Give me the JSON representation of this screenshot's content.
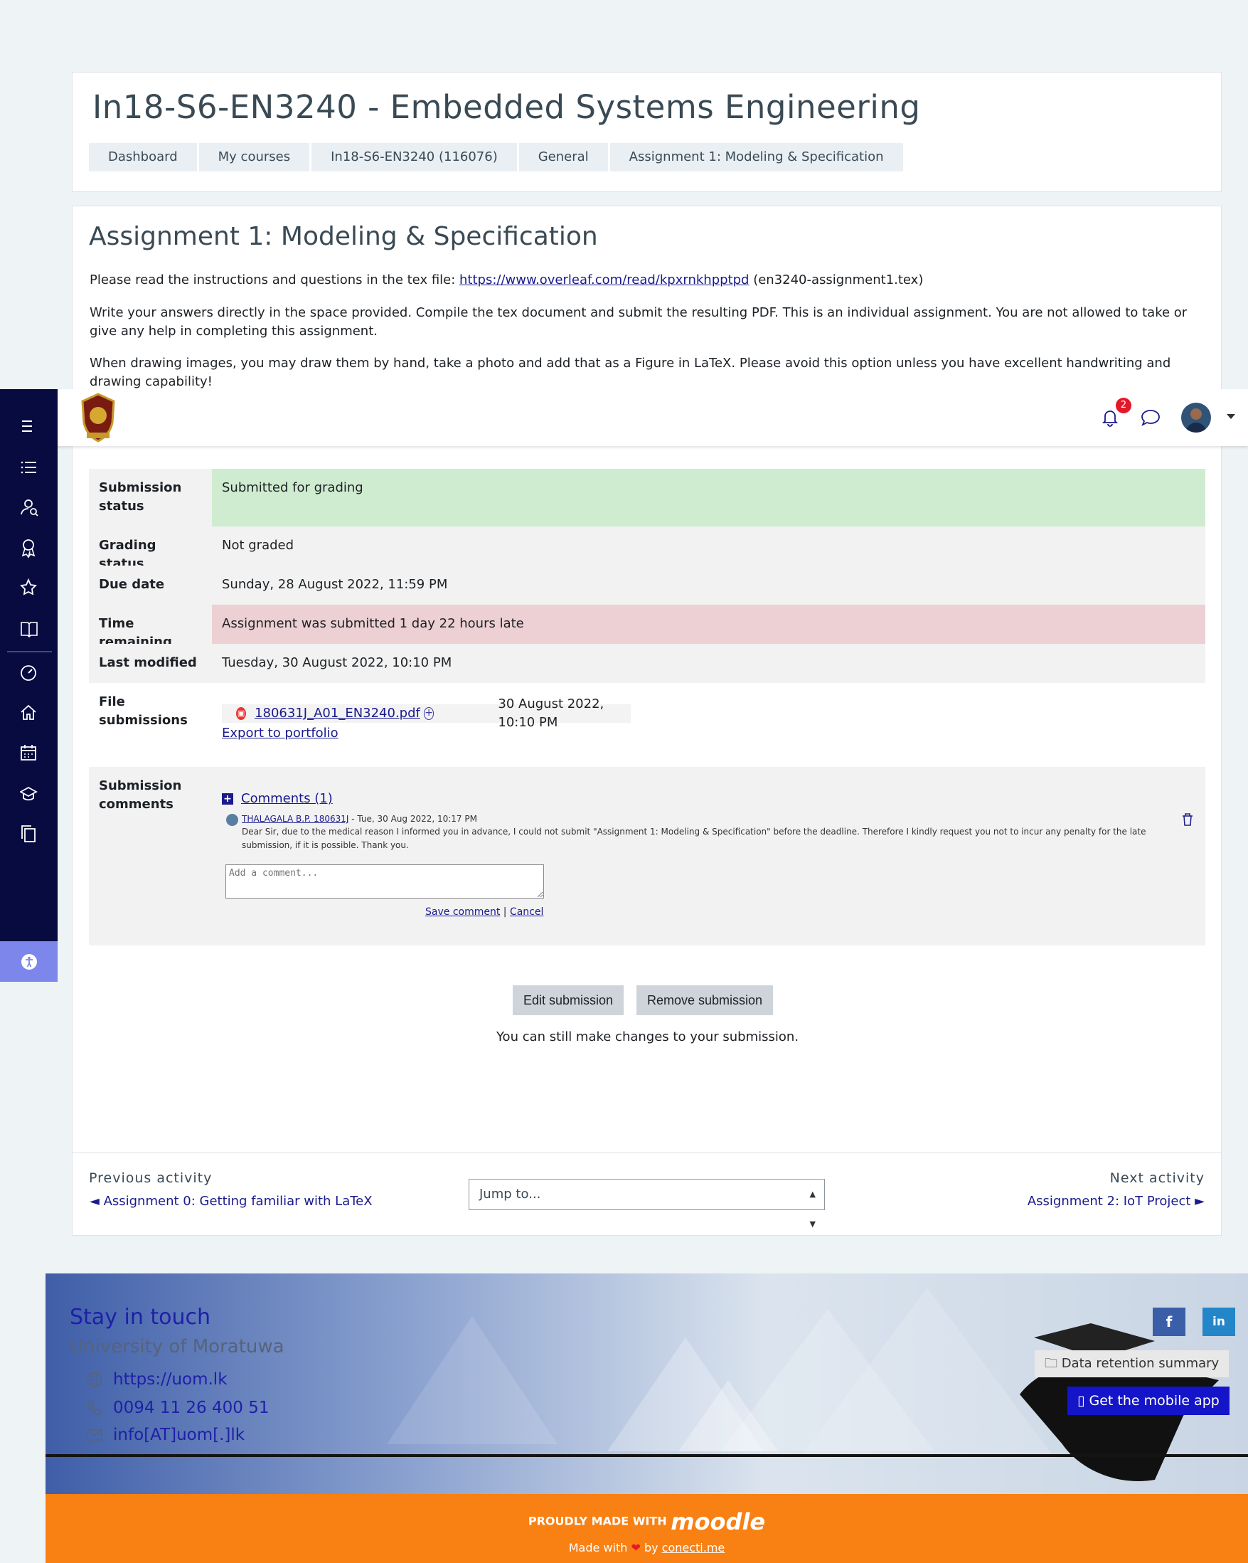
{
  "header": {
    "course_title": "In18-S6-EN3240 - Embedded Systems Engineering",
    "breadcrumb": [
      "Dashboard",
      "My courses",
      "In18-S6-EN3240 (116076)",
      "General",
      "Assignment 1: Modeling & Specification"
    ]
  },
  "assignment": {
    "title": "Assignment 1: Modeling & Specification",
    "intro1_prefix": "Please read the instructions and questions in the tex file: ",
    "intro1_link": "https://www.overleaf.com/read/kpxrnkhpptpd",
    "intro1_suffix": " (en3240-assignment1.tex)",
    "intro2": "Write your answers directly in the space provided. Compile the tex document and submit the resulting PDF. This is an individual assignment. You are not allowed to take or give any help in completing this assignment.",
    "intro3": "When drawing images, you may draw them by hand, take a photo and add that as a Figure in LaTeX. Please avoid this option unless you have excellent handwriting and drawing capability!"
  },
  "status": {
    "submission_status_label": "Submission status",
    "submission_status_value": "Submitted for grading",
    "grading_status_label": "Grading status",
    "grading_status_value": "Not graded",
    "due_date_label": "Due date",
    "due_date_value": "Sunday, 28 August 2022, 11:59 PM",
    "time_remaining_label": "Time remaining",
    "time_remaining_value": "Assignment was submitted 1 day 22 hours late",
    "last_modified_label": "Last modified",
    "last_modified_value": "Tuesday, 30 August 2022, 10:10 PM",
    "file_submissions_label": "File submissions",
    "file_name": "180631J_A01_EN3240.pdf",
    "file_date": "30 August 2022, 10:10 PM",
    "export_portfolio": "Export to portfolio",
    "comments_label": "Submission comments"
  },
  "comments": {
    "toggle": "Comments (1)",
    "author": "THALAGALA B.P. 180631J",
    "date": " - Tue, 30 Aug 2022, 10:17 PM",
    "text": "Dear Sir, due to the medical reason I informed you in advance, I could not submit \"Assignment 1: Modeling & Specification\" before the deadline. Therefore I kindly request you not to incur any penalty for the late submission, if it is possible. Thank you.",
    "placeholder": "Add a comment...",
    "save": "Save comment",
    "separator": " | ",
    "cancel": "Cancel"
  },
  "actions": {
    "edit": "Edit submission",
    "remove": "Remove submission",
    "note": "You can still make changes to your submission."
  },
  "activity_nav": {
    "previous_label": "Previous activity",
    "previous_link": "◄ Assignment 0: Getting familiar with LaTeX",
    "jump_to": "Jump to...",
    "next_label": "Next activity",
    "next_link": "Assignment 2: IoT Project ►"
  },
  "navbar": {
    "notification_count": "2"
  },
  "footer": {
    "stay_in_touch": "Stay in touch",
    "university": "University of Moratuwa",
    "website": "https://uom.lk",
    "phone": "0094 11 26 400 51",
    "email": "info[AT]uom[.]lk",
    "facebook": "f",
    "linkedin": "in",
    "data_retention": "Data retention summary",
    "mobile_app": "Get the mobile app",
    "proudly_made_with": "PROUDLY MADE WITH ",
    "moodle": "moodle",
    "made_with": "Made with ",
    "heart": "❤",
    "by": " by ",
    "conecti": "conecti.me"
  },
  "colors": {
    "sidebar": "#070b3f",
    "submitted_green": "#d0ecd0",
    "late_red": "#ecd0d3",
    "link": "#1a1a8e",
    "footer_orange": "#f98012",
    "accessibility": "#7d86ea",
    "badge_red": "#e4182b"
  },
  "icons": {
    "sidebar": [
      "menu-icon",
      "list-icon",
      "user-search-icon",
      "award-icon",
      "star-icon",
      "book-open-icon",
      "dashboard-gauge-icon",
      "home-icon",
      "calendar-icon",
      "graduation-cap-icon",
      "copy-icon",
      "accessibility-icon"
    ]
  }
}
